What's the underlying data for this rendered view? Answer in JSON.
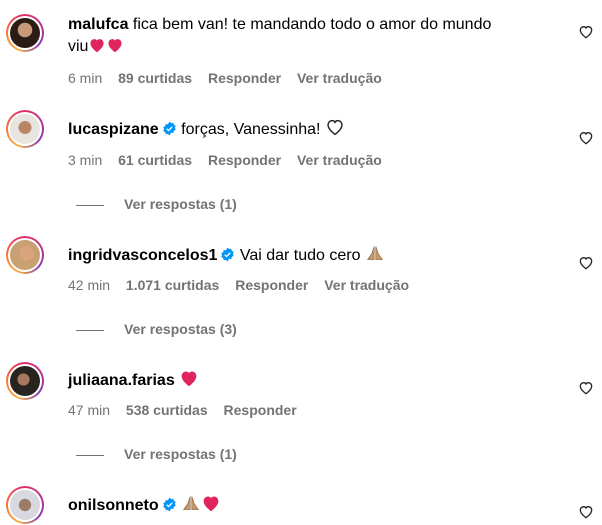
{
  "comments": [
    {
      "username": "malufca",
      "verified": false,
      "text": "fica bem van! te mandando todo o amor do mundo",
      "text_line2": "viu",
      "time": "6 min",
      "likes": "89 curtidas",
      "reply": "Responder",
      "translate": "Ver tradução"
    },
    {
      "username": "lucaspizane",
      "verified": true,
      "text": "forças, Vanessinha!",
      "time": "3 min",
      "likes": "61 curtidas",
      "reply": "Responder",
      "translate": "Ver tradução",
      "view_replies": "Ver respostas (1)"
    },
    {
      "username": "ingridvasconcelos1",
      "verified": true,
      "text": "Vai dar tudo cero",
      "time": "42 min",
      "likes": "1.071 curtidas",
      "reply": "Responder",
      "translate": "Ver tradução",
      "view_replies": "Ver respostas (3)"
    },
    {
      "username": "juliaana.farias",
      "verified": false,
      "text": "",
      "time": "47 min",
      "likes": "538 curtidas",
      "reply": "Responder",
      "view_replies": "Ver respostas (1)"
    },
    {
      "username": "onilsonneto",
      "verified": true,
      "text": ""
    }
  ],
  "colors": {
    "meta": "#737373",
    "verified": "#0095f6",
    "heart": "#e0245e"
  },
  "icons": [
    "heart-outline-icon",
    "verified-badge-icon",
    "red-heart-emoji",
    "praying-hands-emoji",
    "white-heart-emoji"
  ]
}
